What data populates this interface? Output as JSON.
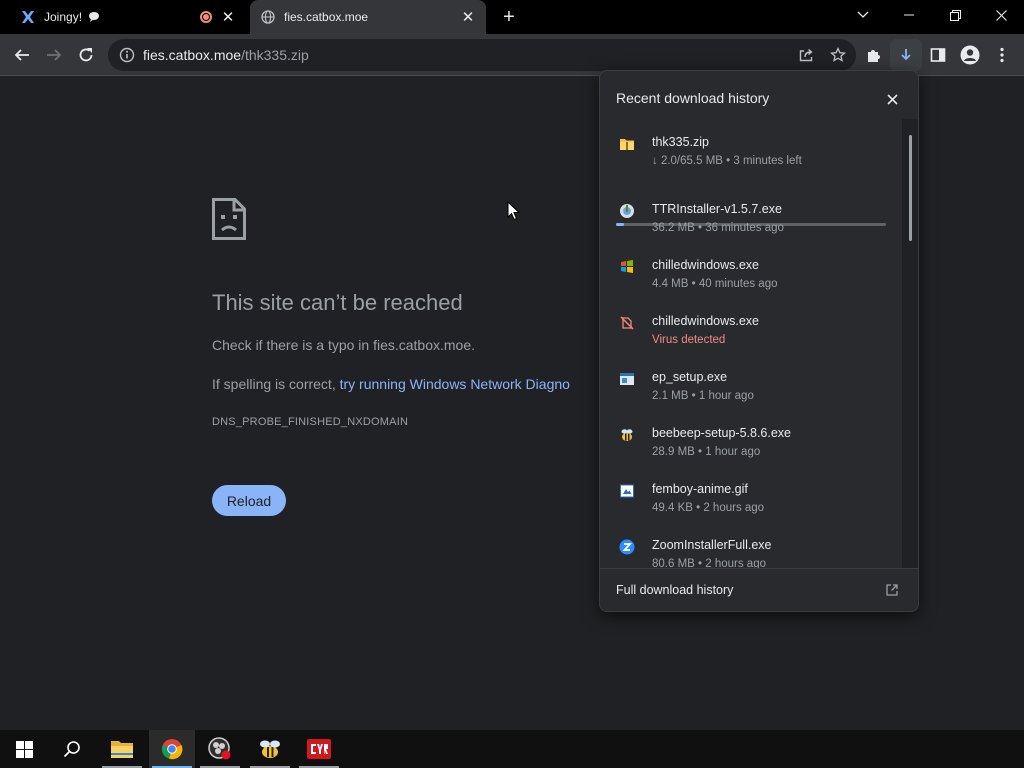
{
  "tabs": [
    {
      "title": "Joingy!",
      "icon": "joingy-logo-icon",
      "badge_icon": "speech-bubble-icon",
      "recording_icon": "recording-indicator-icon",
      "active": false
    },
    {
      "title": "fies.catbox.moe",
      "icon": "globe-icon",
      "active": true
    }
  ],
  "new_tab_label": "+",
  "window_controls": [
    "chevron-down-icon",
    "minimize-icon",
    "restore-icon",
    "close-icon"
  ],
  "address_bar": {
    "host": "fies.catbox.moe",
    "path": "/thk335.zip"
  },
  "error_page": {
    "title": "This site can’t be reached",
    "line1": "Check if there is a typo in fies.catbox.moe.",
    "line2_prefix": "If spelling is correct, ",
    "line2_link": "try running Windows Network Diagno",
    "error_code": "DNS_PROBE_FINISHED_NXDOMAIN",
    "reload_label": "Reload"
  },
  "downloads": {
    "header": "Recent download history",
    "items": [
      {
        "name": "thk335.zip",
        "meta": "↓ 2.0/65.5 MB • 3 minutes left",
        "icon": "zip-folder-icon",
        "warn": false,
        "progress": 0.03
      },
      {
        "name": "TTRInstaller-v1.5.7.exe",
        "meta": "36.2 MB • 36 minutes ago",
        "icon": "installer-icon",
        "warn": false
      },
      {
        "name": "chilledwindows.exe",
        "meta": "4.4 MB • 40 minutes ago",
        "icon": "windows-logo-icon",
        "warn": false
      },
      {
        "name": "chilledwindows.exe",
        "meta": "Virus detected",
        "icon": "blocked-file-icon",
        "warn": true
      },
      {
        "name": "ep_setup.exe",
        "meta": "2.1 MB • 1 hour ago",
        "icon": "setup-window-icon",
        "warn": false
      },
      {
        "name": "beebeep-setup-5.8.6.exe",
        "meta": "28.9 MB • 1 hour ago",
        "icon": "bee-icon",
        "warn": false
      },
      {
        "name": "femboy-anime.gif",
        "meta": "49.4 KB • 2 hours ago",
        "icon": "image-file-icon",
        "warn": false
      },
      {
        "name": "ZoomInstallerFull.exe",
        "meta": "80.6 MB • 2 hours ago",
        "icon": "zoom-logo-icon",
        "warn": false
      }
    ],
    "footer": "Full download history"
  },
  "taskbar": [
    "start-icon",
    "search-icon",
    "file-explorer-icon",
    "chrome-icon",
    "obs-icon",
    "beebeep-icon",
    "cyr-app-icon"
  ],
  "colors": {
    "accent": "#8ab4f8",
    "warn": "#f28b82",
    "background": "#202124",
    "toolbar": "#35363a"
  }
}
